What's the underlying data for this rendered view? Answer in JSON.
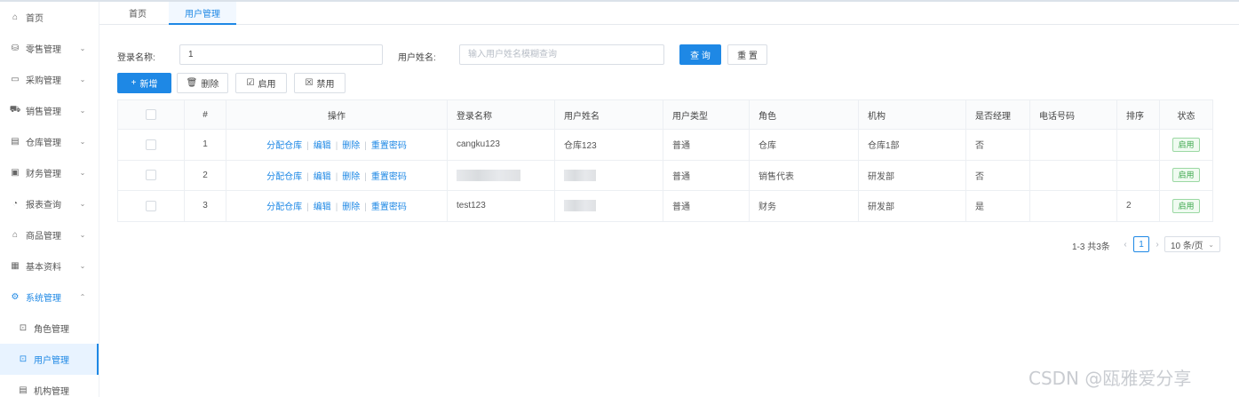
{
  "sidebar": {
    "items": [
      {
        "label": "首页",
        "icon": "home-icon",
        "glyph": "⌂",
        "chevron": ""
      },
      {
        "label": "零售管理",
        "icon": "retail-icon",
        "glyph": "⛁",
        "chevron": "⌄"
      },
      {
        "label": "采购管理",
        "icon": "purchase-icon",
        "glyph": "▭",
        "chevron": "⌄"
      },
      {
        "label": "销售管理",
        "icon": "cart-icon",
        "glyph": "⛟",
        "chevron": "⌄"
      },
      {
        "label": "仓库管理",
        "icon": "warehouse-icon",
        "glyph": "▤",
        "chevron": "⌄"
      },
      {
        "label": "财务管理",
        "icon": "finance-icon",
        "glyph": "▣",
        "chevron": "⌄"
      },
      {
        "label": "报表查询",
        "icon": "report-icon",
        "glyph": "◔",
        "chevron": "⌄"
      },
      {
        "label": "商品管理",
        "icon": "goods-icon",
        "glyph": "⌂",
        "chevron": "⌄"
      },
      {
        "label": "基本资料",
        "icon": "basic-data-icon",
        "glyph": "▦",
        "chevron": "⌄"
      },
      {
        "label": "系统管理",
        "icon": "system-icon",
        "glyph": "⚙",
        "chevron": "⌃"
      }
    ],
    "sub_items": [
      {
        "label": "角色管理",
        "icon": "role-icon",
        "glyph": "⊡"
      },
      {
        "label": "用户管理",
        "icon": "user-icon",
        "glyph": "⊡"
      },
      {
        "label": "机构管理",
        "icon": "org-icon",
        "glyph": "▤"
      }
    ]
  },
  "tabs": [
    {
      "label": "首页",
      "active": false
    },
    {
      "label": "用户管理",
      "active": true
    }
  ],
  "search": {
    "login_label": "登录名称:",
    "login_value": "1",
    "username_label": "用户姓名:",
    "username_placeholder": "输入用户姓名模糊查询",
    "query_button": "查 询",
    "reset_button": "重 置"
  },
  "toolbar": {
    "add": "新增",
    "delete": "删除",
    "enable": "启用",
    "disable": "禁用"
  },
  "table": {
    "headers": [
      "",
      "#",
      "操作",
      "登录名称",
      "用户姓名",
      "用户类型",
      "角色",
      "机构",
      "是否经理",
      "电话号码",
      "排序",
      "状态"
    ],
    "actions": [
      "分配仓库",
      "编辑",
      "删除",
      "重置密码"
    ],
    "rows": [
      {
        "index": "1",
        "login": "cangku123",
        "name": "仓库123",
        "type": "普通",
        "role": "仓库",
        "org": "仓库1部",
        "manager": "否",
        "phone": "",
        "sort": "",
        "status": "启用"
      },
      {
        "index": "2",
        "login": "",
        "name": "",
        "type": "普通",
        "role": "销售代表",
        "org": "研发部",
        "manager": "否",
        "phone": "",
        "sort": "",
        "status": "启用"
      },
      {
        "index": "3",
        "login": "test123",
        "name": "",
        "type": "普通",
        "role": "财务",
        "org": "研发部",
        "manager": "是",
        "phone": "",
        "sort": "2",
        "status": "启用"
      }
    ]
  },
  "pagination": {
    "summary": "1-3 共3条",
    "current_page": "1",
    "page_size": "10 条/页"
  },
  "watermark": "CSDN @瓯雅爱分享",
  "colors": {
    "accent": "#1e88e5",
    "status_green": "#3aa64a"
  }
}
